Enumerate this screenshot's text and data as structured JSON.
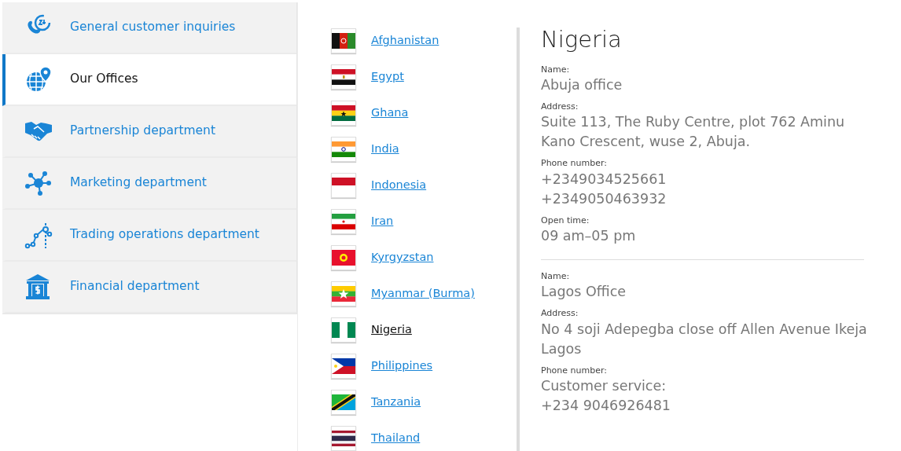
{
  "sidebar": {
    "items": [
      {
        "label": "General customer inquiries",
        "kind": "phone24",
        "selected": false
      },
      {
        "label": "Our Offices",
        "kind": "globe",
        "selected": true
      },
      {
        "label": "Partnership department",
        "kind": "handshake",
        "selected": false
      },
      {
        "label": "Marketing department",
        "kind": "network",
        "selected": false
      },
      {
        "label": "Trading operations department",
        "kind": "chart",
        "selected": false
      },
      {
        "label": "Financial department",
        "kind": "bank",
        "selected": false
      }
    ]
  },
  "countries": [
    {
      "name": "Afghanistan",
      "kind": "af",
      "selected": false
    },
    {
      "name": "Egypt",
      "kind": "eg",
      "selected": false
    },
    {
      "name": "Ghana",
      "kind": "gh",
      "selected": false
    },
    {
      "name": "India",
      "kind": "in",
      "selected": false
    },
    {
      "name": "Indonesia",
      "kind": "id",
      "selected": false
    },
    {
      "name": "Iran",
      "kind": "ir",
      "selected": false
    },
    {
      "name": "Kyrgyzstan",
      "kind": "kg",
      "selected": false
    },
    {
      "name": "Myanmar (Burma)",
      "kind": "mm",
      "selected": false
    },
    {
      "name": "Nigeria",
      "kind": "ng",
      "selected": true
    },
    {
      "name": "Philippines",
      "kind": "ph",
      "selected": false
    },
    {
      "name": "Tanzania",
      "kind": "tz",
      "selected": false
    },
    {
      "name": "Thailand",
      "kind": "th",
      "selected": false
    }
  ],
  "detail": {
    "title": "Nigeria",
    "offices": [
      {
        "fields": [
          {
            "label": "Name:",
            "lines": [
              "Abuja office"
            ]
          },
          {
            "label": "Address:",
            "lines": [
              "Suite 113, The Ruby Centre, plot 762 Aminu Kano Crescent, wuse 2, Abuja."
            ]
          },
          {
            "label": "Phone number:",
            "lines": [
              "+2349034525661",
              "+2349050463932"
            ]
          },
          {
            "label": "Open time:",
            "lines": [
              "09 am–05 pm"
            ]
          }
        ]
      },
      {
        "fields": [
          {
            "label": "Name:",
            "lines": [
              "Lagos Office"
            ]
          },
          {
            "label": "Address:",
            "lines": [
              "No 4 soji Adepegba close off Allen Avenue Ikeja Lagos"
            ]
          },
          {
            "label": "Phone number:",
            "lines": [
              "Customer service:",
              "+234 9046926481"
            ]
          }
        ]
      }
    ]
  }
}
